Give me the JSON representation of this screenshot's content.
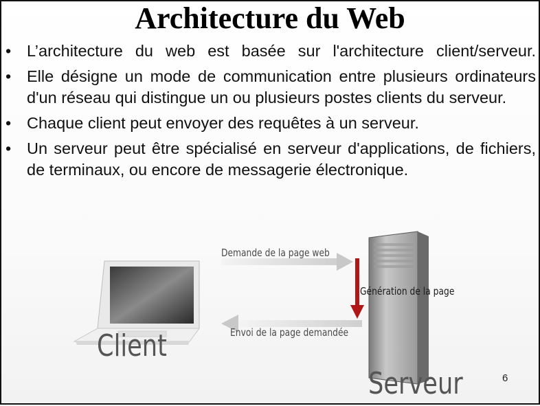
{
  "slide": {
    "title": "Architecture du Web",
    "bullets": [
      {
        "marker": "•",
        "text": "L’architecture du web est basée sur l'architecture client/serveur."
      },
      {
        "marker": "•",
        "text": "Elle désigne un mode de communication entre plusieurs ordinateurs d'un réseau qui distingue un ou plusieurs postes clients du serveur."
      },
      {
        "marker": "•",
        "text": "Chaque client peut envoyer des requêtes à un serveur."
      },
      {
        "marker": "•",
        "text": "Un serveur peut être spécialisé en serveur d'applications, de fichiers, de terminaux, ou encore de messagerie électronique."
      }
    ],
    "page_number": "6"
  },
  "diagram": {
    "request_label": "Demande de la page web",
    "generation_label": "Génération de la page",
    "response_label": "Envoi de la page demandée",
    "client_label": "Client",
    "server_label": "Serveur",
    "icons": [
      "laptop-icon",
      "server-tower-icon"
    ],
    "colors": {
      "generation_arrow": "#b01818",
      "flow_arrows": "#cfcfcf"
    }
  }
}
